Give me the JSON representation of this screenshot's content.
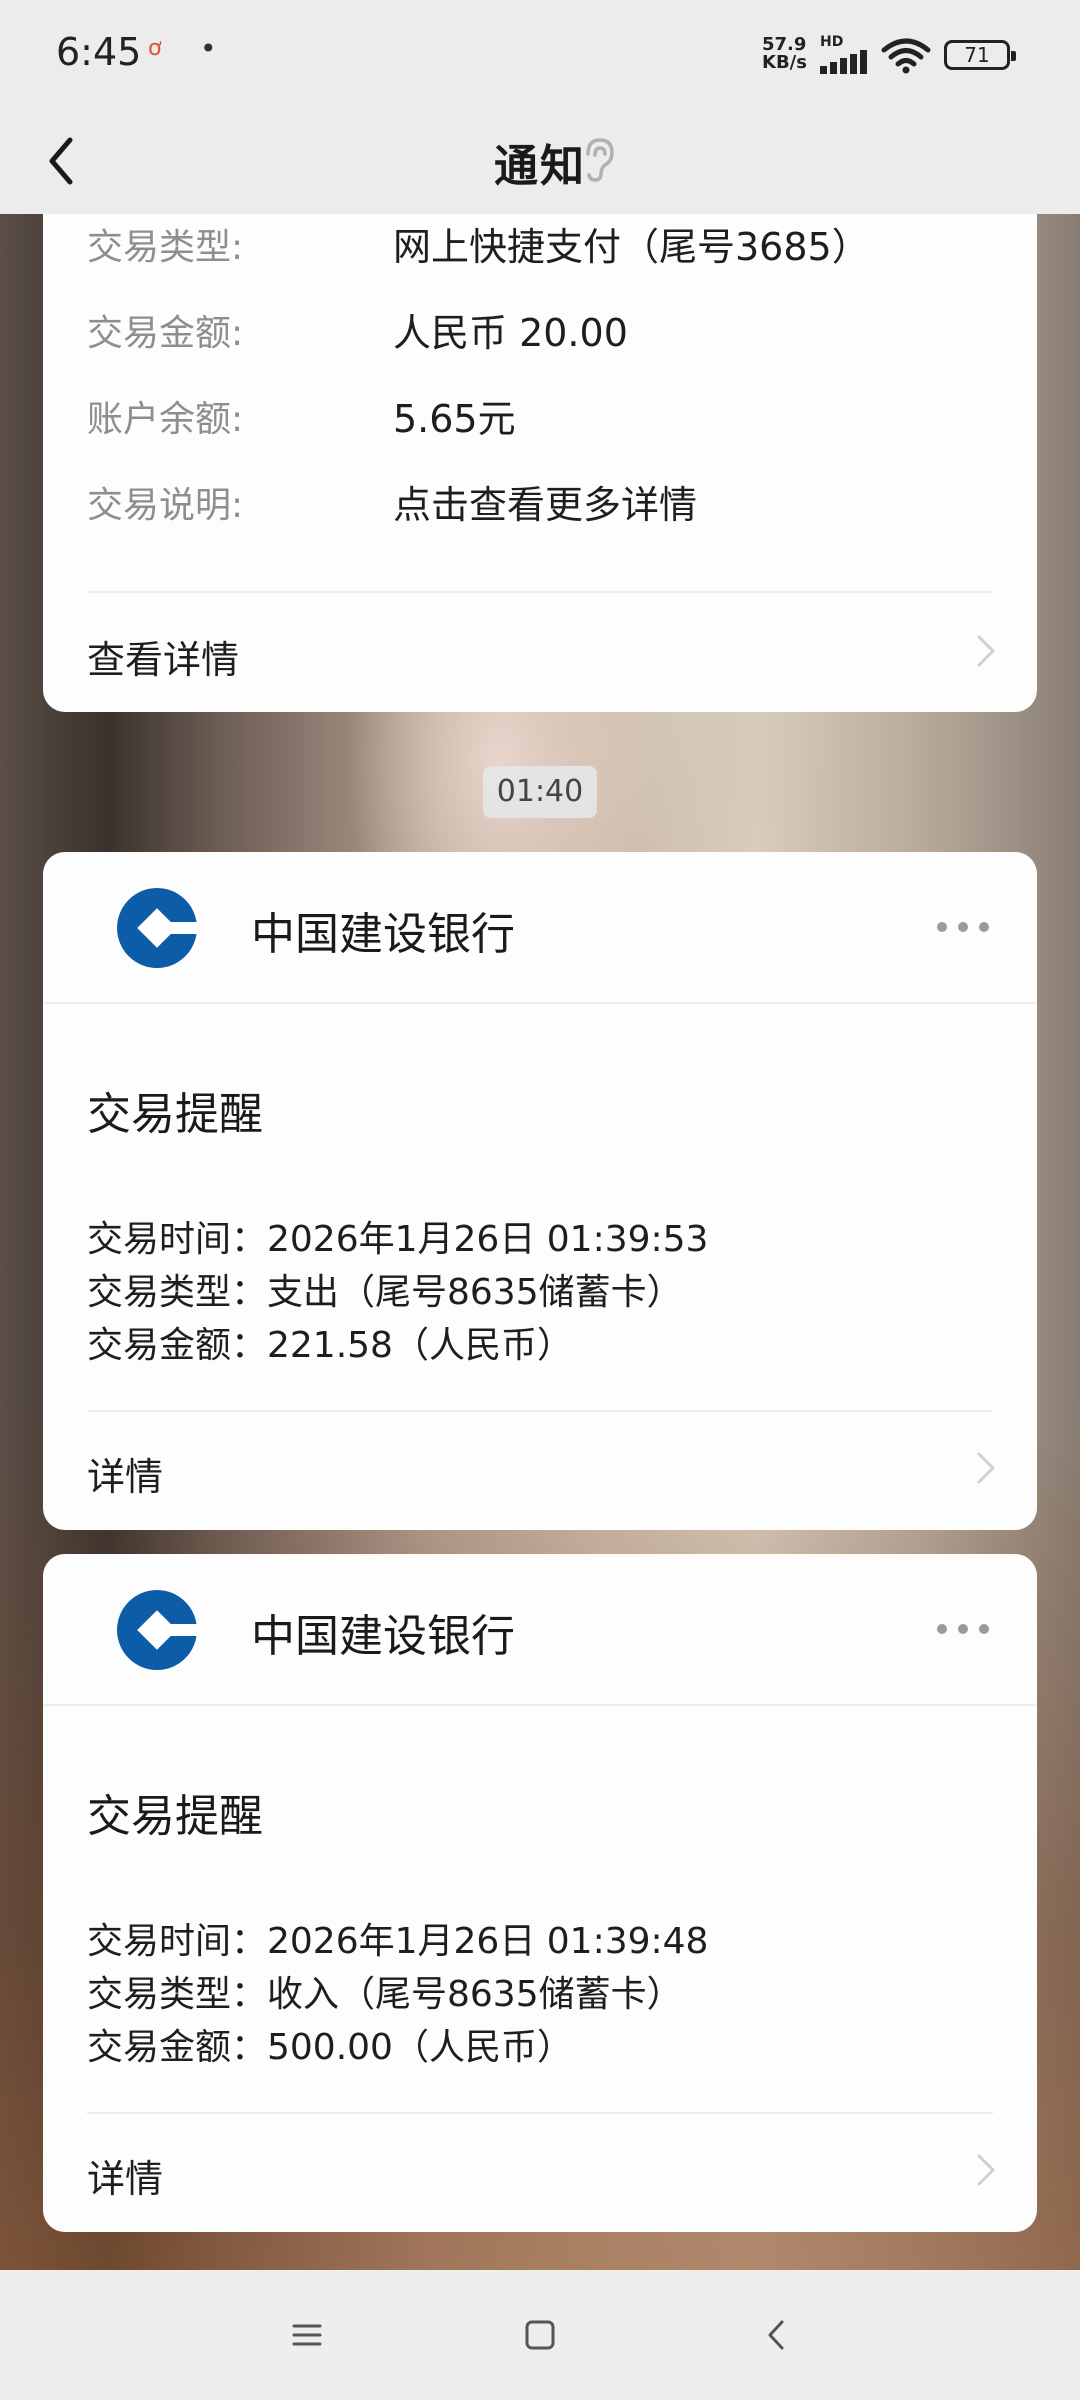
{
  "status_bar": {
    "time": "6:45",
    "net_speed_value": "57.9",
    "net_speed_unit": "KB/s",
    "hd_label": "HD",
    "battery": "71"
  },
  "header": {
    "title": "通知"
  },
  "top_card": {
    "rows": [
      {
        "label": "交易类型:",
        "value": "网上快捷支付（尾号3685）"
      },
      {
        "label": "交易金额:",
        "value": "人民币 20.00"
      },
      {
        "label": "账户余额:",
        "value": "5.65元"
      },
      {
        "label": "交易说明:",
        "value": "点击查看更多详情"
      }
    ],
    "link_label": "查看详情"
  },
  "timestamp": "01:40",
  "cards": [
    {
      "bank_name": "中国建设银行",
      "title": "交易提醒",
      "lines": [
        "交易时间：2026年1月26日 01:39:53",
        "交易类型：支出（尾号8635储蓄卡）",
        "交易金额：221.58（人民币）"
      ],
      "link_label": "详情"
    },
    {
      "bank_name": "中国建设银行",
      "title": "交易提醒",
      "lines": [
        "交易时间：2026年1月26日 01:39:48",
        "交易类型：收入（尾号8635储蓄卡）",
        "交易金额：500.00（人民币）"
      ],
      "link_label": "详情"
    }
  ],
  "colors": {
    "bank_blue": "#0d5ca8",
    "card_bg": "#fdfdfd",
    "bar_bg": "#ececec"
  },
  "icons": {
    "back": "chevron-left-icon",
    "ear": "ear-icon",
    "more": "more-dots-icon",
    "menu": "menu-icon",
    "home": "home-square-icon",
    "nav_back": "nav-back-icon"
  }
}
